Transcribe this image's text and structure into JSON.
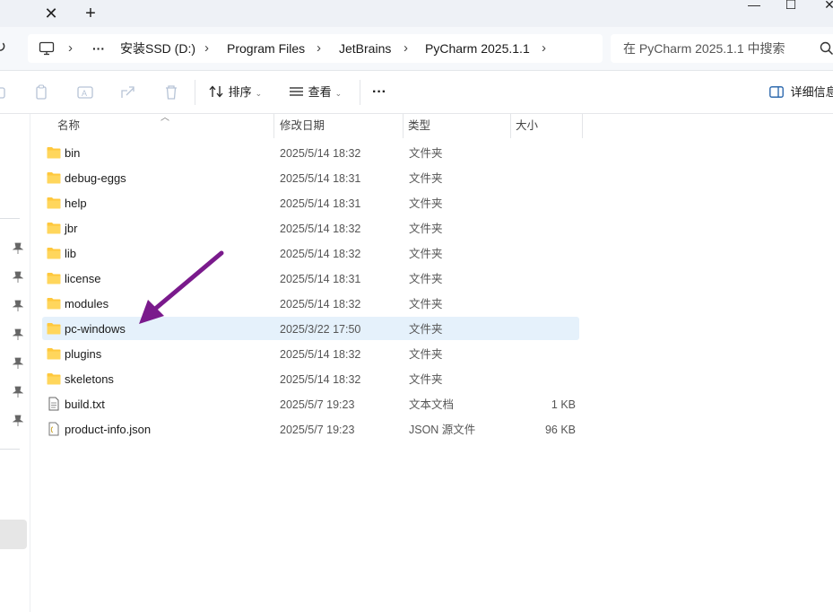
{
  "titlebar": {
    "close_tab": "✕",
    "new_tab": "+"
  },
  "window_controls": {
    "minimize": "—",
    "maximize": "☐",
    "close": "✕"
  },
  "breadcrumb": {
    "more": "···",
    "items": [
      "安装SSD (D:)",
      "Program Files",
      "JetBrains",
      "PyCharm 2025.1.1"
    ]
  },
  "search": {
    "placeholder": "在 PyCharm 2025.1.1 中搜索"
  },
  "toolbar": {
    "sort_label": "排序",
    "view_label": "查看",
    "more_label": "···",
    "details_label": "详细信息"
  },
  "columns": {
    "name": "名称",
    "date": "修改日期",
    "type": "类型",
    "size": "大小"
  },
  "files": [
    {
      "name": "bin",
      "date": "2025/5/14 18:32",
      "type": "文件夹",
      "size": "",
      "icon": "folder-icon"
    },
    {
      "name": "debug-eggs",
      "date": "2025/5/14 18:31",
      "type": "文件夹",
      "size": "",
      "icon": "folder-icon"
    },
    {
      "name": "help",
      "date": "2025/5/14 18:31",
      "type": "文件夹",
      "size": "",
      "icon": "folder-icon"
    },
    {
      "name": "jbr",
      "date": "2025/5/14 18:32",
      "type": "文件夹",
      "size": "",
      "icon": "folder-icon"
    },
    {
      "name": "lib",
      "date": "2025/5/14 18:32",
      "type": "文件夹",
      "size": "",
      "icon": "folder-icon"
    },
    {
      "name": "license",
      "date": "2025/5/14 18:31",
      "type": "文件夹",
      "size": "",
      "icon": "folder-icon"
    },
    {
      "name": "modules",
      "date": "2025/5/14 18:32",
      "type": "文件夹",
      "size": "",
      "icon": "folder-icon"
    },
    {
      "name": "pc-windows",
      "date": "2025/3/22 17:50",
      "type": "文件夹",
      "size": "",
      "icon": "folder-icon",
      "selected": true
    },
    {
      "name": "plugins",
      "date": "2025/5/14 18:32",
      "type": "文件夹",
      "size": "",
      "icon": "folder-icon"
    },
    {
      "name": "skeletons",
      "date": "2025/5/14 18:32",
      "type": "文件夹",
      "size": "",
      "icon": "folder-icon"
    },
    {
      "name": "build.txt",
      "date": "2025/5/7 19:23",
      "type": "文本文档",
      "size": "1 KB",
      "icon": "text-file-icon"
    },
    {
      "name": "product-info.json",
      "date": "2025/5/7 19:23",
      "type": "JSON 源文件",
      "size": "96 KB",
      "icon": "json-file-icon"
    }
  ],
  "colors": {
    "folder": "#ffc83d",
    "selected_row": "#e5f1fb",
    "annotation_arrow": "#7a1a8c"
  }
}
